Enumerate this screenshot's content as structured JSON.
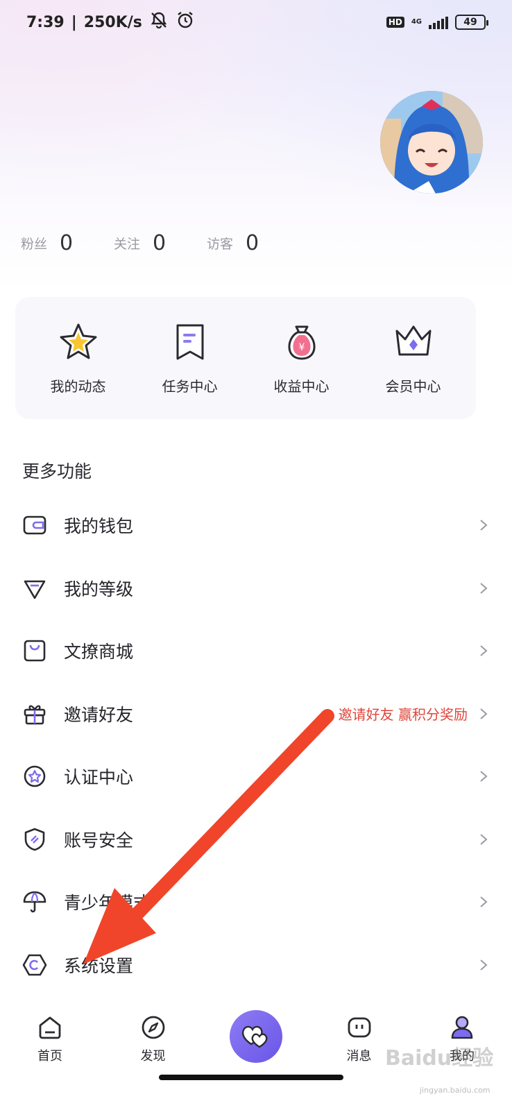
{
  "status_bar": {
    "time": "7:39",
    "separator": "|",
    "speed": "250K/s",
    "hd": "HD",
    "network": "4G",
    "battery": "49"
  },
  "stats": [
    {
      "label": "粉丝",
      "value": "0"
    },
    {
      "label": "关注",
      "value": "0"
    },
    {
      "label": "访客",
      "value": "0"
    }
  ],
  "quick_actions": [
    {
      "label": "我的动态",
      "icon": "star-icon"
    },
    {
      "label": "任务中心",
      "icon": "bookmark-icon"
    },
    {
      "label": "收益中心",
      "icon": "money-bag-icon"
    },
    {
      "label": "会员中心",
      "icon": "crown-icon"
    }
  ],
  "section_title": "更多功能",
  "menu": [
    {
      "label": "我的钱包",
      "icon": "wallet-icon",
      "extra": ""
    },
    {
      "label": "我的等级",
      "icon": "diamond-icon",
      "extra": ""
    },
    {
      "label": "文撩商城",
      "icon": "shopping-bag-icon",
      "extra": ""
    },
    {
      "label": "邀请好友",
      "icon": "gift-icon",
      "extra": "邀请好友 赢积分奖励"
    },
    {
      "label": "认证中心",
      "icon": "badge-star-icon",
      "extra": ""
    },
    {
      "label": "账号安全",
      "icon": "shield-icon",
      "extra": ""
    },
    {
      "label": "青少年模式",
      "icon": "umbrella-icon",
      "extra": ""
    },
    {
      "label": "系统设置",
      "icon": "hexagon-settings-icon",
      "extra": ""
    }
  ],
  "bottom_nav": [
    {
      "label": "首页",
      "icon": "home-icon"
    },
    {
      "label": "发现",
      "icon": "compass-icon"
    },
    {
      "label": "",
      "icon": "hearts-icon"
    },
    {
      "label": "消息",
      "icon": "message-icon"
    },
    {
      "label": "我的",
      "icon": "profile-icon"
    }
  ],
  "watermark": {
    "text": "Baidu经验",
    "sub": "jingyan.baidu.com"
  },
  "colors": {
    "accent": "#6a55e6",
    "promo_red": "#e0463c",
    "annotation_red": "#f0452a"
  }
}
